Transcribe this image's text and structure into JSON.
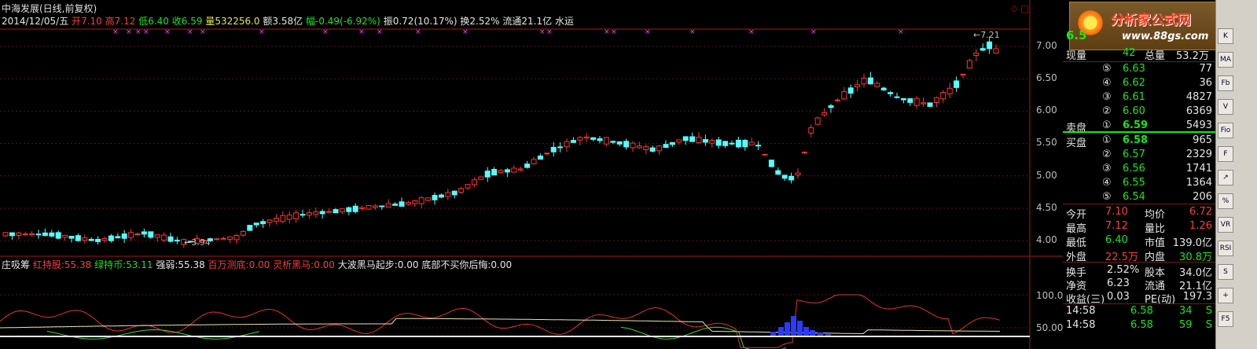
{
  "header": {
    "title": "中海发展(日线,前复权)",
    "date": "2014/12/05/五",
    "open_label": "开",
    "open": "7.10",
    "high_label": "高",
    "high": "7.12",
    "low_label": "低",
    "low": "6.40",
    "close_label": "收",
    "close": "6.59",
    "vol_label": "量",
    "volume": "532256.0",
    "amount_label": "额",
    "amount": "3.58亿",
    "change_label": "幅",
    "change": "-0.49(-6.92%)",
    "amp_label": "振",
    "amplitude": "0.72(10.17%)",
    "turnover_label": "换",
    "turnover": "2.52%",
    "float_label": "流通",
    "float_shares": "21.1亿",
    "sector": "水运"
  },
  "y_axis": [
    "7.00",
    "6.50",
    "6.00",
    "5.50",
    "5.00",
    "4.50",
    "4.00"
  ],
  "indicator": {
    "name": "庄吸筹",
    "items": [
      {
        "label": "红持股:",
        "value": "55.38",
        "color": "red"
      },
      {
        "label": "绿持币:",
        "value": "53.11",
        "color": "green"
      },
      {
        "label": "强弱:",
        "value": "55.38",
        "color": "white"
      },
      {
        "label": "百万测底:",
        "value": "0.00",
        "color": "red"
      },
      {
        "label": "灵析黑马:",
        "value": "0.00",
        "color": "red"
      },
      {
        "label": "大波黑马起步:",
        "value": "0.00",
        "color": "white"
      },
      {
        "label": "底部不买你后悔:",
        "value": "0.00",
        "color": "white"
      }
    ],
    "y_axis": [
      "100.0",
      "50.00"
    ]
  },
  "annotations": {
    "low_mark": "3.94",
    "high_mark": "7.21"
  },
  "right_panel": {
    "logo_title": "分析家公式网",
    "logo_url": "www.88gs.com",
    "price_partial": "6.5",
    "now_vol_label": "现量",
    "now_vol": "42",
    "total_vol_label": "总量",
    "total_vol": "53.2万",
    "asks": [
      {
        "level": "⑤",
        "price": "6.63",
        "vol": "77"
      },
      {
        "level": "④",
        "price": "6.62",
        "vol": "36"
      },
      {
        "level": "③",
        "price": "6.61",
        "vol": "4827"
      },
      {
        "level": "②",
        "price": "6.60",
        "vol": "6369"
      },
      {
        "level": "①",
        "price": "6.59",
        "vol": "5493",
        "label": "卖盘"
      }
    ],
    "bids": [
      {
        "level": "①",
        "price": "6.58",
        "vol": "965",
        "label": "买盘"
      },
      {
        "level": "②",
        "price": "6.57",
        "vol": "2329"
      },
      {
        "level": "③",
        "price": "6.56",
        "vol": "1741"
      },
      {
        "level": "④",
        "price": "6.55",
        "vol": "1364"
      },
      {
        "level": "⑤",
        "price": "6.54",
        "vol": "206"
      }
    ],
    "stats": [
      {
        "l1": "今开",
        "v1": "7.10",
        "c1": "red",
        "l2": "均价",
        "v2": "6.72",
        "c2": "red"
      },
      {
        "l1": "最高",
        "v1": "7.12",
        "c1": "red",
        "l2": "量比",
        "v2": "1.26",
        "c2": "red"
      },
      {
        "l1": "最低",
        "v1": "6.40",
        "c1": "green",
        "l2": "市值",
        "v2": "139.0亿",
        "c2": "white"
      },
      {
        "l1": "外盘",
        "v1": "22.5万",
        "c1": "red",
        "l2": "内盘",
        "v2": "30.8万",
        "c2": "green"
      }
    ],
    "fundamentals": [
      {
        "l1": "换手",
        "v1": "2.52%",
        "l2": "股本",
        "v2": "34.0亿"
      },
      {
        "l1": "净资",
        "v1": "6.23",
        "l2": "流通",
        "v2": "21.1亿"
      },
      {
        "l1": "收益(三)",
        "v1": "0.03",
        "l2": "PE(动)",
        "v2": "197.3"
      }
    ],
    "ticks": [
      {
        "time": "14:58",
        "price": "6.58",
        "vol": "34",
        "side": "S"
      },
      {
        "time": "14:58",
        "price": "6.58",
        "vol": "59",
        "side": "S"
      }
    ]
  },
  "toolbar": [
    "K",
    "MA",
    "Fb",
    "V",
    "Fio",
    "F",
    "↗",
    "%",
    "VR",
    "RSI",
    "S",
    "+",
    "F5"
  ]
}
